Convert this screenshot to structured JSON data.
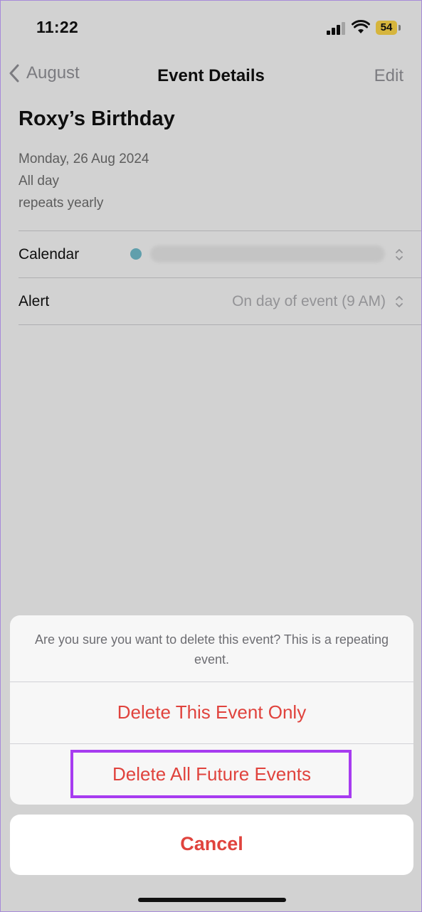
{
  "status_bar": {
    "time": "11:22",
    "battery": "54",
    "icons": [
      "cellular-signal-icon",
      "wifi-icon",
      "battery-icon"
    ]
  },
  "nav": {
    "back_label": "August",
    "title": "Event Details",
    "edit_label": "Edit"
  },
  "event": {
    "title": "Roxy’s Birthday",
    "date": "Monday, 26 Aug 2024",
    "duration": "All day",
    "repeat": "repeats yearly"
  },
  "rows": {
    "calendar_label": "Calendar",
    "alert_label": "Alert",
    "alert_value": "On day of event (9 AM)"
  },
  "action_sheet": {
    "message": "Are you sure you want to delete this event? This is a repeating event.",
    "delete_this_label": "Delete This Event Only",
    "delete_future_label": "Delete All Future Events",
    "cancel_label": "Cancel"
  },
  "colors": {
    "destructive": "#e0433d",
    "highlight": "#a73cf0",
    "calendar_dot": "#6fb7c6",
    "battery": "#f6d047"
  }
}
